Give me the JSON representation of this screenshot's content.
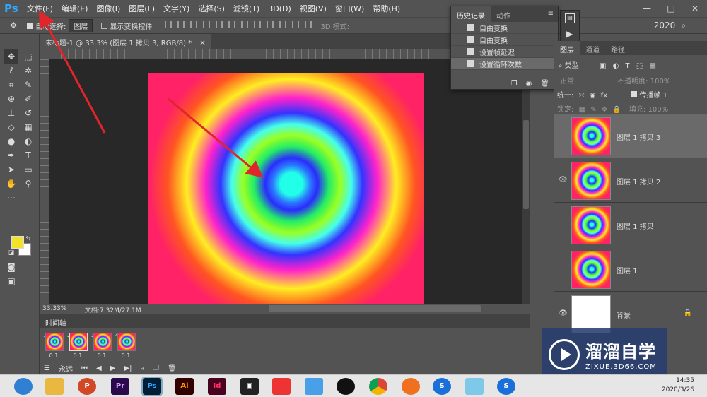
{
  "app": {
    "logo": "Ps",
    "menu": [
      "文件(F)",
      "编辑(E)",
      "图像(I)",
      "图层(L)",
      "文字(Y)",
      "选择(S)",
      "滤镜(T)",
      "3D(D)",
      "视图(V)",
      "窗口(W)",
      "帮助(H)"
    ],
    "window_controls": [
      "—",
      "□",
      "✕"
    ]
  },
  "options": {
    "auto_select_label": "自动选择:",
    "auto_select_value": "图层",
    "transform_label": "显示变换控件",
    "mode_3d": "3D 模式:",
    "zoom_counter": "2020"
  },
  "document": {
    "tab_title": "未标题-1 @ 33.3% (图层 1 拷贝 3, RGB/8) *",
    "zoom": "33.33%",
    "doc_size": "文档:7.32M/27.1M"
  },
  "history": {
    "tabs": [
      "历史记录",
      "动作"
    ],
    "items": [
      "自由变换",
      "自由变换",
      "设置帧延迟",
      "设置循环次数"
    ],
    "selected_index": 3
  },
  "timeline": {
    "title": "时间轴",
    "frames": [
      {
        "num": "1",
        "delay": "0.1"
      },
      {
        "num": "2",
        "delay": "0.1"
      },
      {
        "num": "3",
        "delay": "0.1"
      },
      {
        "num": "4",
        "delay": "0.1"
      }
    ],
    "loop": "永远",
    "controls": [
      "⏮",
      "◀",
      "▶",
      "▶|"
    ]
  },
  "layers": {
    "tabs": [
      "图层",
      "通道",
      "路径"
    ],
    "filter_label": "类型",
    "blend_mode": "正常",
    "opacity_label": "不透明度:",
    "opacity_value": "100%",
    "unify_label": "统一:",
    "propagate_label": "传播帧 1",
    "lock_label": "锁定:",
    "fill_label": "填充:",
    "fill_value": "100%",
    "items": [
      {
        "name": "图层 1 拷贝 3",
        "visible": false,
        "selected": true
      },
      {
        "name": "图层 1 拷贝 2",
        "visible": true,
        "selected": false
      },
      {
        "name": "图层 1 拷贝",
        "visible": false,
        "selected": false
      },
      {
        "name": "图层 1",
        "visible": false,
        "selected": false
      },
      {
        "name": "背景",
        "visible": true,
        "selected": false,
        "locked": true
      }
    ]
  },
  "watermark": {
    "title": "溜溜自学",
    "url": "ZIXUE.3D66.COM"
  },
  "taskbar": {
    "icons": [
      "search",
      "explorer",
      "powerpoint",
      "premiere",
      "photoshop",
      "illustrator",
      "indesign",
      "video-editor",
      "game",
      "chat",
      "qq",
      "chrome",
      "browser",
      "search-app",
      "app",
      "search-app-2"
    ],
    "time": "14:35",
    "date": "2020/3/26"
  },
  "colors": {
    "accent": "#31a8ff",
    "annotation_arrow": "#e0262a",
    "foreground": "#f2e32a",
    "background": "#ffffff"
  }
}
